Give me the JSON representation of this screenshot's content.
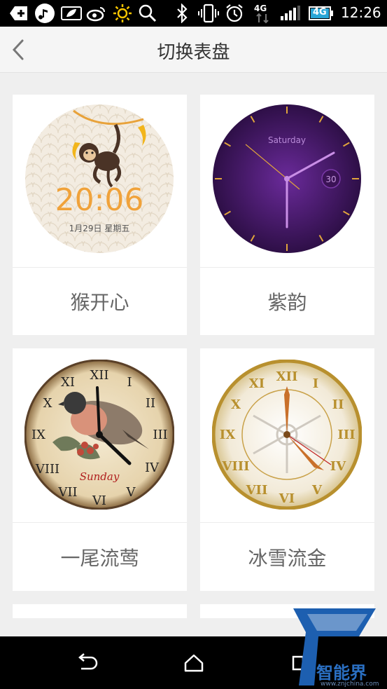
{
  "status_bar": {
    "time": "12:26",
    "network": "4G",
    "icons": [
      "add-icon",
      "music-icon",
      "leaf-icon",
      "weibo-icon",
      "brightness-icon",
      "search-icon",
      "bluetooth-icon",
      "vibrate-icon",
      "alarm-icon",
      "4g-data-icon",
      "signal-icon",
      "battery-icon"
    ]
  },
  "header": {
    "title": "切换表盘",
    "back_icon": "chevron-left-icon"
  },
  "watch_faces": [
    {
      "name": "猴开心",
      "time": "20:06",
      "date": "1月29日 星期五"
    },
    {
      "name": "紫韵",
      "day": "Saturday",
      "date_num": "30"
    },
    {
      "name": "一尾流莺",
      "day": "Sunday"
    },
    {
      "name": "冰雪流金"
    }
  ],
  "nav_bar": {
    "icons": [
      "back-icon",
      "home-icon",
      "recents-icon"
    ]
  },
  "watermark": {
    "text": "智能界",
    "url": "www.znjchina.com"
  },
  "colors": {
    "accent_orange": "#f0a23a",
    "purple": "#4a1a6e",
    "gold": "#c9a24a"
  }
}
